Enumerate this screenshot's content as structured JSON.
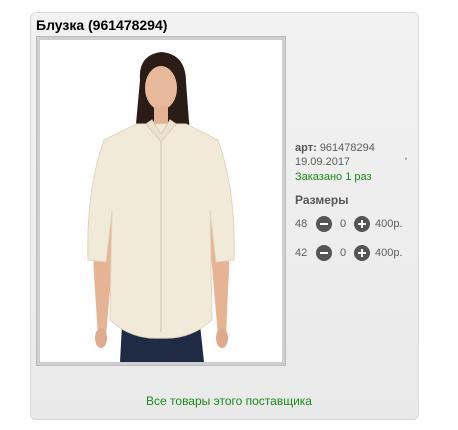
{
  "product": {
    "title": "Блузка (961478294)",
    "art_label": "арт:",
    "art_value": "961478294",
    "date": "19.09.2017",
    "date_mark": "'",
    "ordered": "Заказано 1 раз"
  },
  "sizes": {
    "heading": "Размеры",
    "rows": [
      {
        "size": "48",
        "qty": "0",
        "price": "400р."
      },
      {
        "size": "42",
        "qty": "0",
        "price": "400р."
      }
    ]
  },
  "footer": {
    "supplier_link": "Все товары этого поставщика"
  },
  "colors": {
    "link_green": "#1a8a1a",
    "button_gray": "#555555",
    "card_bg": "#ececec"
  },
  "icons": [
    "minus-circle-icon",
    "plus-circle-icon"
  ]
}
